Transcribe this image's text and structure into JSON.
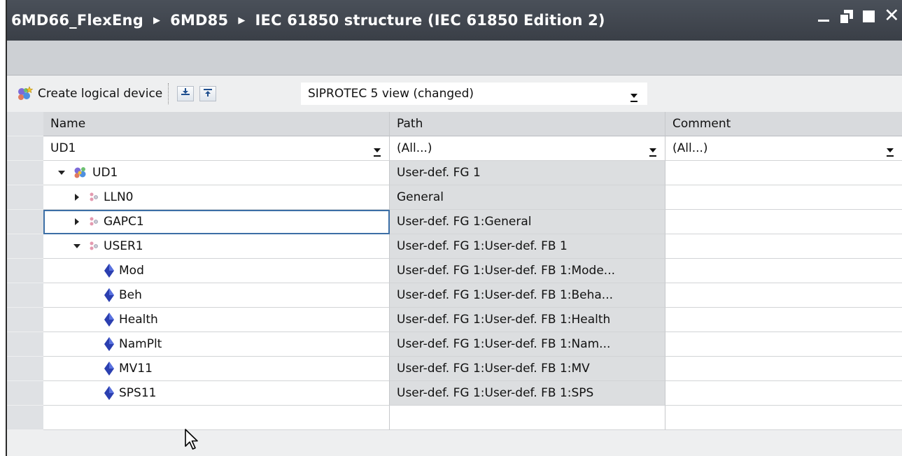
{
  "title": {
    "breadcrumbs": [
      "6MD66_FlexEng",
      "6MD85",
      "IEC 61850 structure (IEC 61850 Edition 2)"
    ]
  },
  "toolbar": {
    "create_label": "Create logical device",
    "view_select": "SIPROTEC 5 view (changed)"
  },
  "table": {
    "columns": [
      "Name",
      "Path",
      "Comment"
    ],
    "filters": [
      "UD1",
      "(All...)",
      "(All...)"
    ],
    "rows": [
      {
        "name": "UD1",
        "path": "User-def. FG 1",
        "comment": "",
        "level": 0,
        "expander": "expanded",
        "icon": "logical-device-icon"
      },
      {
        "name": "LLN0",
        "path": "General",
        "comment": "",
        "level": 1,
        "expander": "collapsed",
        "icon": "logical-node-icon"
      },
      {
        "name": "GAPC1",
        "path": "User-def. FG 1:General",
        "comment": "",
        "level": 1,
        "expander": "collapsed",
        "icon": "logical-node-icon",
        "selected": true
      },
      {
        "name": "USER1",
        "path": "User-def. FG 1:User-def. FB 1",
        "comment": "",
        "level": 1,
        "expander": "expanded",
        "icon": "logical-node-icon"
      },
      {
        "name": "Mod",
        "path": "User-def. FG 1:User-def. FB 1:Mode...",
        "comment": "",
        "level": 2,
        "icon": "data-object-icon"
      },
      {
        "name": "Beh",
        "path": "User-def. FG 1:User-def. FB 1:Beha...",
        "comment": "",
        "level": 2,
        "icon": "data-object-icon"
      },
      {
        "name": "Health",
        "path": "User-def. FG 1:User-def. FB 1:Health",
        "comment": "",
        "level": 2,
        "icon": "data-object-icon"
      },
      {
        "name": "NamPlt",
        "path": "User-def. FG 1:User-def. FB 1:Nam...",
        "comment": "",
        "level": 2,
        "icon": "data-object-icon"
      },
      {
        "name": "MV11",
        "path": "User-def. FG 1:User-def. FB 1:MV",
        "comment": "",
        "level": 2,
        "icon": "data-object-icon"
      },
      {
        "name": "SPS11",
        "path": "User-def. FG 1:User-def. FB 1:SPS",
        "comment": "",
        "level": 2,
        "icon": "data-object-icon"
      },
      {
        "name": "",
        "path": "",
        "comment": "",
        "level": 0,
        "icon": ""
      }
    ]
  },
  "colors": {
    "title_bar": "#3d424a",
    "selection_border": "#3c6fa6",
    "path_column_bg": "#dcdee0",
    "diamond_icon": "#2b3fb0"
  }
}
